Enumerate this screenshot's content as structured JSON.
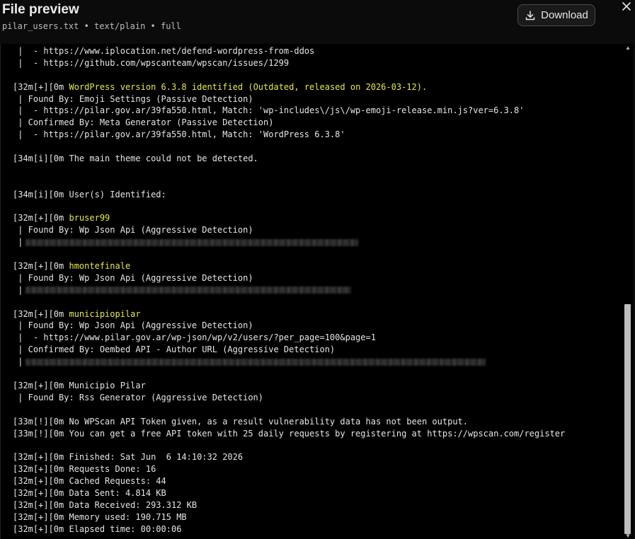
{
  "header": {
    "title": "File preview",
    "meta": "pilar_users.txt • text/plain • full",
    "download_label": "Download"
  },
  "icons": {
    "download": "download-icon",
    "close": "close-icon"
  },
  "colors": {
    "background": "#000000",
    "text": "#e6e6e6",
    "highlight": "#e8e84a"
  },
  "lines": [
    {
      "text": " |  - https://www.iplocation.net/defend-wordpress-from-ddos"
    },
    {
      "text": " |  - https://github.com/wpscanteam/wpscan/issues/1299"
    },
    {
      "text": ""
    },
    {
      "prefix": "[32m[+][0m ",
      "text": "WordPress version 6.3.8 identified (Outdated, released on 2026-03-12).",
      "hl": true
    },
    {
      "text": " | Found By: Emoji Settings (Passive Detection)"
    },
    {
      "text": " |  - https://pilar.gov.ar/39fa550.html, Match: 'wp-includes\\/js\\/wp-emoji-release.min.js?ver=6.3.8'"
    },
    {
      "text": " | Confirmed By: Meta Generator (Passive Detection)"
    },
    {
      "text": " |  - https://pilar.gov.ar/39fa550.html, Match: 'WordPress 6.3.8'"
    },
    {
      "text": ""
    },
    {
      "text": "[34m[i][0m The main theme could not be detected."
    },
    {
      "text": ""
    },
    {
      "text": ""
    },
    {
      "text": "[34m[i][0m User(s) Identified:"
    },
    {
      "text": ""
    },
    {
      "prefix": "[32m[+][0m ",
      "text": "bruser99",
      "hl": true
    },
    {
      "text": " | Found By: Wp Json Api (Aggressive Detection)"
    },
    {
      "text": " |",
      "blur": 470
    },
    {
      "text": ""
    },
    {
      "prefix": "[32m[+][0m ",
      "text": "hmontefinale",
      "hl": true
    },
    {
      "text": " | Found By: Wp Json Api (Aggressive Detection)"
    },
    {
      "text": " |",
      "blur": 460
    },
    {
      "text": ""
    },
    {
      "prefix": "[32m[+][0m ",
      "text": "municipiopilar",
      "hl": true
    },
    {
      "text": " | Found By: Wp Json Api (Aggressive Detection)"
    },
    {
      "text": " |  - https://www.pilar.gov.ar/wp-json/wp/v2/users/?per_page=100&page=1"
    },
    {
      "text": " | Confirmed By: Oembed API - Author URL (Aggressive Detection)"
    },
    {
      "text": " |",
      "blur": 650
    },
    {
      "text": ""
    },
    {
      "text": "[32m[+][0m Municipio Pilar"
    },
    {
      "text": " | Found By: Rss Generator (Aggressive Detection)"
    },
    {
      "text": ""
    },
    {
      "text": "[33m[!][0m No WPScan API Token given, as a result vulnerability data has not been output."
    },
    {
      "text": "[33m[!][0m You can get a free API token with 25 daily requests by registering at https://wpscan.com/register"
    },
    {
      "text": ""
    },
    {
      "text": "[32m[+][0m Finished: Sat Jun  6 14:10:32 2026"
    },
    {
      "text": "[32m[+][0m Requests Done: 16"
    },
    {
      "text": "[32m[+][0m Cached Requests: 44"
    },
    {
      "text": "[32m[+][0m Data Sent: 4.814 KB"
    },
    {
      "text": "[32m[+][0m Data Received: 293.312 KB"
    },
    {
      "text": "[32m[+][0m Memory used: 190.715 MB"
    },
    {
      "text": "[32m[+][0m Elapsed time: 00:00:06"
    }
  ]
}
